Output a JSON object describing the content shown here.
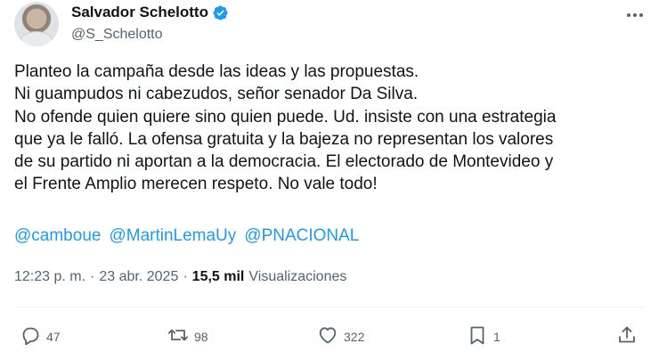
{
  "author": {
    "display_name": "Salvador Schelotto",
    "handle": "@S_Schelotto",
    "verified_icon": "verified-badge-icon",
    "verified_color": "#1d9bf0"
  },
  "tweet": {
    "text": "Planteo la campaña desde las ideas y las propuestas.\nNi guampudos ni cabezudos, señor senador Da Silva.\nNo ofende quien quiere sino quien puede. Ud. insiste con una estrategia\nque ya le falló. La ofensa gratuita y la bajeza no representan los valores\nde su partido ni aportan a la democracia. El electorado de Montevideo y\nel Frente Amplio merecen respeto. No vale todo!",
    "mentions": [
      "@camboue",
      "@MartinLemaUy",
      "@PNACIONAL"
    ],
    "link_color": "#1d9bf0"
  },
  "meta": {
    "time": "12:23 p. m.",
    "separator": "·",
    "date": "23 abr. 2025",
    "views_count": "15,5 mil",
    "views_label": "Visualizaciones"
  },
  "actions": {
    "replies": "47",
    "reposts": "98",
    "likes": "322",
    "bookmarks": "1"
  },
  "icons": {
    "more": "more-dots-icon",
    "reply": "reply-icon",
    "repost": "repost-icon",
    "like": "heart-icon",
    "bookmark": "bookmark-icon",
    "share": "share-icon"
  }
}
